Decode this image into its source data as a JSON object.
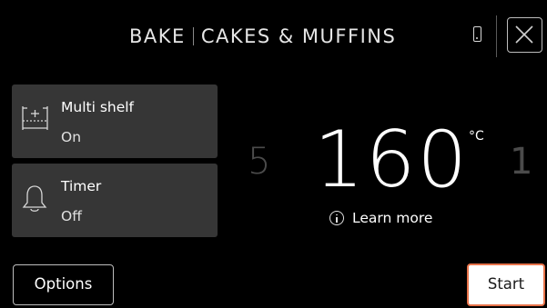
{
  "header": {
    "mode": "BAKE",
    "program": "CAKES & MUFFINS",
    "icons": {
      "device": "phone-icon",
      "close": "close-icon"
    }
  },
  "settings": [
    {
      "label": "Multi shelf",
      "value": "On",
      "icon": "multi-shelf-icon"
    },
    {
      "label": "Timer",
      "value": "Off",
      "icon": "bell-icon"
    }
  ],
  "temperature": {
    "previous": "5",
    "current": "160",
    "unit": "°C",
    "next": "1"
  },
  "learn_more": {
    "label": "Learn more",
    "icon": "info-icon"
  },
  "footer": {
    "options_label": "Options",
    "start_label": "Start"
  },
  "colors": {
    "background": "#000000",
    "card": "#363636",
    "accent": "#e8734a",
    "dim_text": "#4b4b4b"
  }
}
